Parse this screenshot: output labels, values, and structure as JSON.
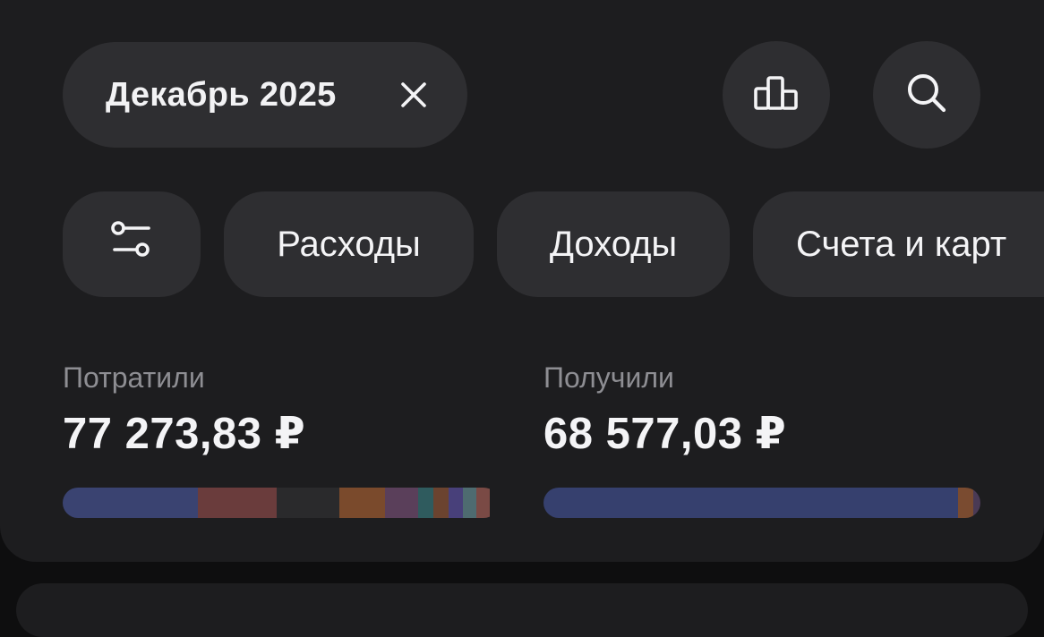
{
  "header": {
    "period_label": "Декабрь 2025",
    "close_icon": "close-icon",
    "chart_icon": "bar-chart-icon",
    "search_icon": "search-icon"
  },
  "filters": {
    "filter_icon": "sliders-icon",
    "chips": [
      {
        "label": "Расходы"
      },
      {
        "label": "Доходы"
      },
      {
        "label": "Счета и карт"
      }
    ]
  },
  "summary": {
    "spent": {
      "label": "Потратили",
      "amount": "77 273,83 ₽",
      "breakdown": [
        {
          "share": 0.31,
          "color": "#3a4371"
        },
        {
          "share": 0.18,
          "color": "#6a3c3c"
        },
        {
          "share": 0.145,
          "color": "#2a2a2c"
        },
        {
          "share": 0.105,
          "color": "#7a4a2c"
        },
        {
          "share": 0.075,
          "color": "#5a3f5a"
        },
        {
          "share": 0.035,
          "color": "#2f5b5e"
        },
        {
          "share": 0.035,
          "color": "#6b432f"
        },
        {
          "share": 0.033,
          "color": "#48407a"
        },
        {
          "share": 0.03,
          "color": "#4e6b70"
        },
        {
          "share": 0.032,
          "color": "#7a4a45"
        }
      ]
    },
    "received": {
      "label": "Получили",
      "amount": "68 577,03 ₽",
      "breakdown": [
        {
          "share": 0.948,
          "color": "#36406e"
        },
        {
          "share": 0.035,
          "color": "#7a4b30"
        },
        {
          "share": 0.017,
          "color": "#4a3a55"
        }
      ]
    }
  }
}
